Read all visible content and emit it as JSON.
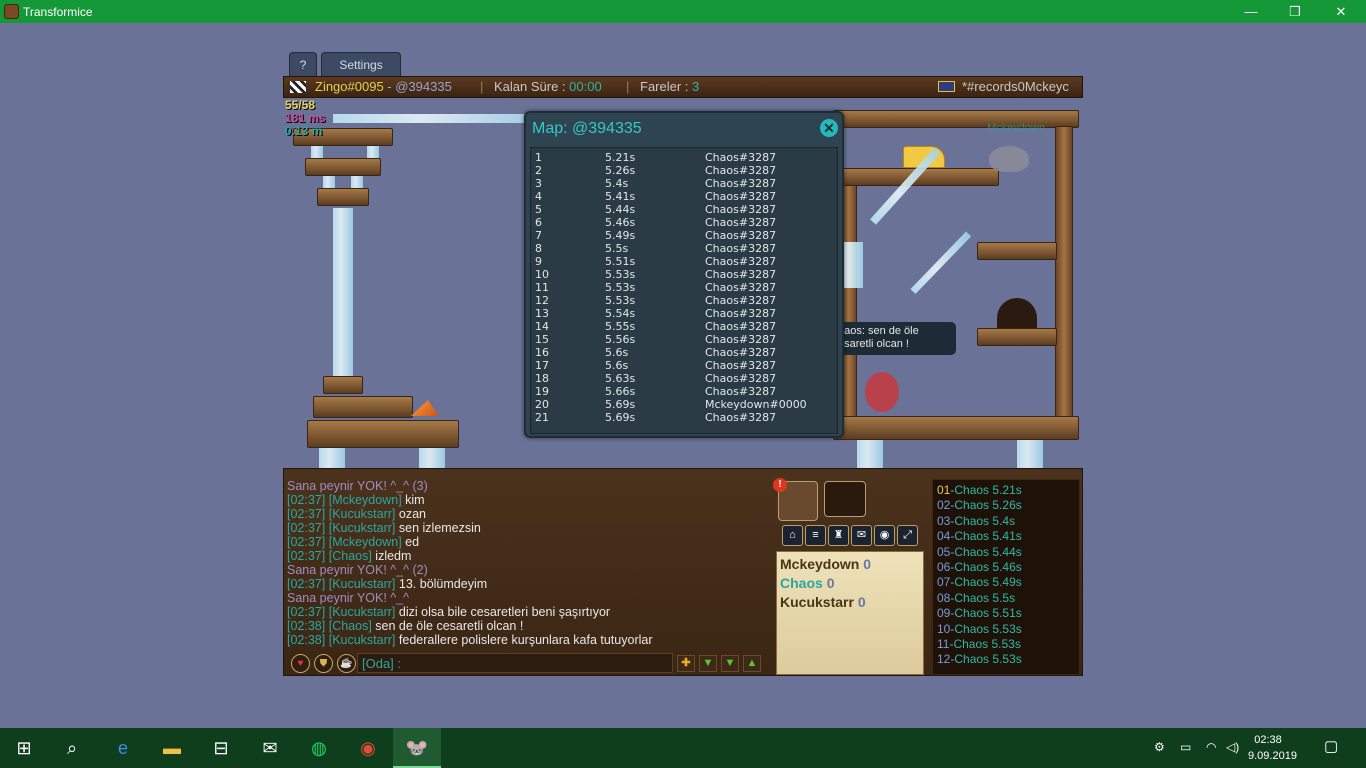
{
  "window": {
    "title": "Transformice",
    "minimize": "—",
    "maximize": "❐",
    "close": "✕"
  },
  "tabs": {
    "help": "?",
    "settings": "Settings"
  },
  "topbar": {
    "room_player": "Zingo#0095",
    "dash": " - ",
    "map_code": "@394335",
    "time_label": "Kalan Süre :",
    "time_value": "00:00",
    "mice_label": "Fareler :",
    "mice_value": "3",
    "room_name": "*#records0Mckeyc"
  },
  "stats": {
    "fps": "55/58",
    "ping": "181 ms",
    "mem": "0.13 m"
  },
  "map_player_tag": "Mckeydown",
  "records": {
    "title": "Map: @394335",
    "close": "✕",
    "rows": [
      [
        "1",
        "5.21s",
        "Chaos#3287"
      ],
      [
        "2",
        "5.26s",
        "Chaos#3287"
      ],
      [
        "3",
        "5.4s",
        "Chaos#3287"
      ],
      [
        "4",
        "5.41s",
        "Chaos#3287"
      ],
      [
        "5",
        "5.44s",
        "Chaos#3287"
      ],
      [
        "6",
        "5.46s",
        "Chaos#3287"
      ],
      [
        "7",
        "5.49s",
        "Chaos#3287"
      ],
      [
        "8",
        "5.5s",
        "Chaos#3287"
      ],
      [
        "9",
        "5.51s",
        "Chaos#3287"
      ],
      [
        "10",
        "5.53s",
        "Chaos#3287"
      ],
      [
        "11",
        "5.53s",
        "Chaos#3287"
      ],
      [
        "12",
        "5.53s",
        "Chaos#3287"
      ],
      [
        "13",
        "5.54s",
        "Chaos#3287"
      ],
      [
        "14",
        "5.55s",
        "Chaos#3287"
      ],
      [
        "15",
        "5.56s",
        "Chaos#3287"
      ],
      [
        "16",
        "5.6s",
        "Chaos#3287"
      ],
      [
        "17",
        "5.6s",
        "Chaos#3287"
      ],
      [
        "18",
        "5.63s",
        "Chaos#3287"
      ],
      [
        "19",
        "5.66s",
        "Chaos#3287"
      ],
      [
        "20",
        "5.69s",
        "Mckeydown#0000"
      ],
      [
        "21",
        "5.69s",
        "Chaos#3287"
      ]
    ]
  },
  "bubble": {
    "line1": "haos: sen de öle",
    "line2": "esaretli olcan !"
  },
  "chat": [
    {
      "sys": "Sana peynir YOK! ^_^ (3)"
    },
    {
      "time": "[02:37]",
      "nick": "[Mckeydown]",
      "msg": "kim"
    },
    {
      "time": "[02:37]",
      "nick": "[Kucukstarr]",
      "msg": "ozan"
    },
    {
      "time": "[02:37]",
      "nick": "[Kucukstarr]",
      "msg": "sen izlemezsin"
    },
    {
      "time": "[02:37]",
      "nick": "[Mckeydown]",
      "msg": "ed"
    },
    {
      "time": "[02:37]",
      "nick": "[Chaos]",
      "msg": "izledm"
    },
    {
      "sys": "Sana peynir YOK! ^_^ (2)"
    },
    {
      "time": "[02:37]",
      "nick": "[Kucukstarr]",
      "msg": "13. bölümdeyim"
    },
    {
      "sys": "Sana peynir YOK! ^_^"
    },
    {
      "time": "[02:37]",
      "nick": "[Kucukstarr]",
      "msg": "dizi olsa bile cesaretleri beni şaşırtıyor"
    },
    {
      "time": "[02:38]",
      "nick": "[Chaos]",
      "msg": "sen de öle cesaretli olcan !"
    },
    {
      "time": "[02:38]",
      "nick": "[Kucukstarr]",
      "msg": "federallere polislere kurşunlara kafa tutuyorlar"
    }
  ],
  "chat_input": {
    "value": "[Oda] :"
  },
  "players": [
    {
      "name": "Mckeydown",
      "score": "0",
      "color": "#4a3418"
    },
    {
      "name": "Chaos",
      "score": "0",
      "color": "#2aa7a0"
    },
    {
      "name": "Kucukstarr",
      "score": "0",
      "color": "#4a3418"
    }
  ],
  "scoreboard": [
    {
      "n": "01",
      "name": "Chaos",
      "t": "5.21s"
    },
    {
      "n": "02",
      "name": "Chaos",
      "t": "5.26s"
    },
    {
      "n": "03",
      "name": "Chaos",
      "t": "5.4s"
    },
    {
      "n": "04",
      "name": "Chaos",
      "t": "5.41s"
    },
    {
      "n": "05",
      "name": "Chaos",
      "t": "5.44s"
    },
    {
      "n": "06",
      "name": "Chaos",
      "t": "5.46s"
    },
    {
      "n": "07",
      "name": "Chaos",
      "t": "5.49s"
    },
    {
      "n": "08",
      "name": "Chaos",
      "t": "5.5s"
    },
    {
      "n": "09",
      "name": "Chaos",
      "t": "5.51s"
    },
    {
      "n": "10",
      "name": "Chaos",
      "t": "5.53s"
    },
    {
      "n": "11",
      "name": "Chaos",
      "t": "5.53s"
    },
    {
      "n": "12",
      "name": "Chaos",
      "t": "5.53s"
    }
  ],
  "taskbar": {
    "time": "02:38",
    "date": "9.09.2019"
  },
  "colors": {
    "titlebar": "#159838",
    "taskbar": "#0f3e1d",
    "accent_cyan": "#2aa7a0",
    "gold": "#e9cb43"
  }
}
